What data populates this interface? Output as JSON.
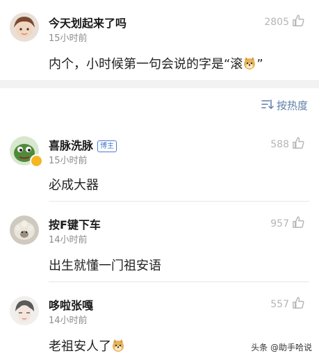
{
  "top_comment": {
    "username": "今天划起来了吗",
    "time": "15小时前",
    "likes": "2805",
    "text_before": "内个，小时候第一句会说的字是“滚",
    "text_after": "”",
    "emoji": "doge-emoji"
  },
  "sort": {
    "label": "按热度",
    "icon": "sort-icon"
  },
  "replies": [
    {
      "username": "喜脉洗脉",
      "badge": "博主",
      "time": "15小时前",
      "likes": "588",
      "text": "必成大器",
      "verified": true
    },
    {
      "username": "按F键下车",
      "time": "14小时前",
      "likes": "957",
      "text": "出生就懂一门祖安语"
    },
    {
      "username": "哆啦张嘎",
      "time": "14小时前",
      "likes": "557",
      "text": "老祖安人了",
      "emoji": "doge-emoji"
    }
  ],
  "watermark": "头条 @助手哈说",
  "colors": {
    "accent": "#5d7fa8",
    "muted": "#8c8c8c",
    "like": "#b5b5b5"
  }
}
